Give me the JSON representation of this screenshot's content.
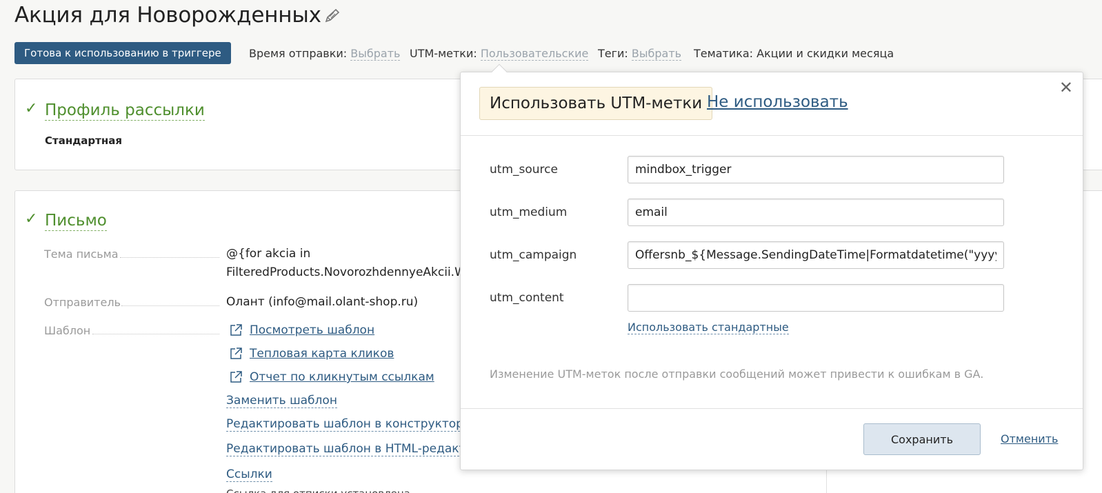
{
  "page": {
    "title": "Акция для Новорожденных"
  },
  "meta_bar": {
    "status": "Готова к использованию в триггере",
    "send_time_label": "Время отправки:",
    "send_time_value": "Выбрать",
    "utm_label": "UTM-метки:",
    "utm_value": "Пользовательские",
    "tags_label": "Теги:",
    "tags_value": "Выбрать",
    "theme_label": "Тематика:",
    "theme_value": "Акции и скидки месяца"
  },
  "profile_section": {
    "title": "Профиль рассылки",
    "value": "Стандартная"
  },
  "letter_section": {
    "title": "Письмо",
    "subject_label": "Тема письма",
    "subject_line1": "@{for akcia in",
    "subject_line2": "FilteredProducts.NovorozhdennyeAkcii.W",
    "sender_label": "Отправитель",
    "sender_value": "Олант (info@mail.olant-shop.ru)",
    "template_label": "Шаблон",
    "view_template": "Посмотреть шаблон",
    "heatmap": "Тепловая карта кликов",
    "click_report": "Отчет по кликнутым ссылкам",
    "replace_template": "Заменить шаблон",
    "edit_constructor": "Редактировать шаблон в конструкторе",
    "edit_html": "Редактировать шаблон в HTML-редакто",
    "links": "Ссылки",
    "cut_off_text": "Ссылка для отписки установлена"
  },
  "utm_popover": {
    "use_utm": "Использовать UTM-метки",
    "dont_use": "Не использовать",
    "fields": [
      {
        "label": "utm_source",
        "value": "mindbox_trigger"
      },
      {
        "label": "utm_medium",
        "value": "email"
      },
      {
        "label": "utm_campaign",
        "value": "Offersnb_${Message.SendingDateTime|Formatdatetime(\"yyyyMMdd\")}"
      },
      {
        "label": "utm_content",
        "value": ""
      }
    ],
    "use_standard": "Использовать стандартные",
    "warning": "Изменение UTM-меток после отправки сообщений может привести к ошибкам в GA.",
    "save": "Сохранить",
    "cancel": "Отменить"
  },
  "icons": {
    "edit": "pencil-icon",
    "check": "checkmark-icon",
    "external": "external-link-icon",
    "close": "close-icon"
  },
  "colors": {
    "brand": "#2e5b82",
    "success": "#4f8f2e",
    "toggle_bg": "#fdf5e2"
  }
}
